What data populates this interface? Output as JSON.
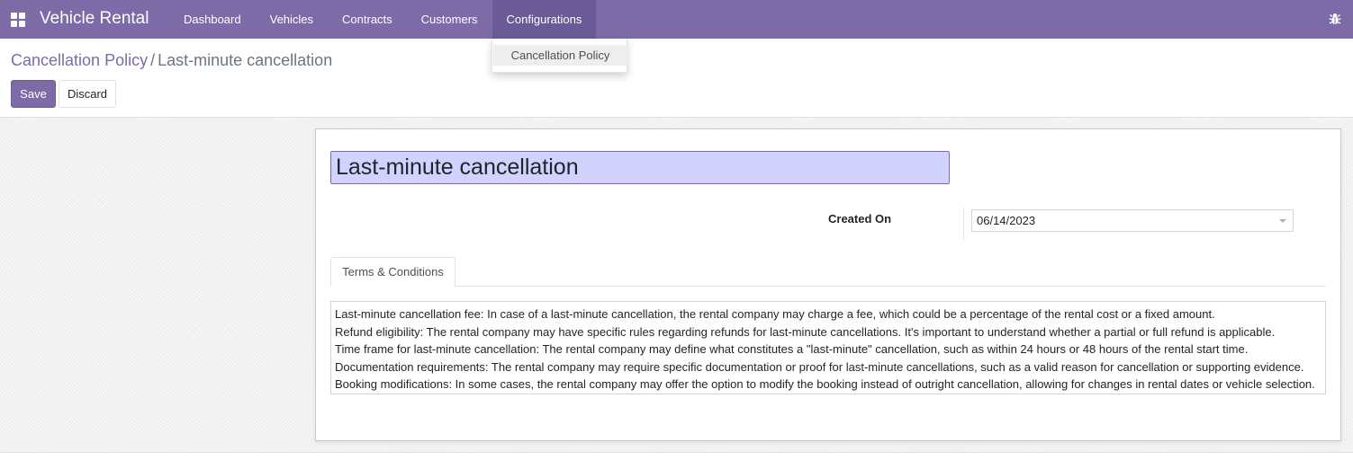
{
  "navbar": {
    "app_icon": "apps-grid-icon",
    "brand": "Vehicle Rental",
    "menu": [
      {
        "label": "Dashboard"
      },
      {
        "label": "Vehicles"
      },
      {
        "label": "Contracts"
      },
      {
        "label": "Customers"
      },
      {
        "label": "Configurations"
      }
    ],
    "active_menu": "Configurations",
    "debug_icon": "bug-icon"
  },
  "dropdown": {
    "items": [
      {
        "label": "Cancellation Policy"
      }
    ]
  },
  "breadcrumb": {
    "parent": "Cancellation Policy",
    "separator": "/",
    "current": "Last-minute cancellation"
  },
  "buttons": {
    "save": "Save",
    "discard": "Discard"
  },
  "form": {
    "name": "Last-minute cancellation",
    "created_on_label": "Created On",
    "created_on_value": "06/14/2023",
    "tab": "Terms & Conditions",
    "terms_lines": [
      "Last-minute cancellation fee: In case of a last-minute cancellation, the rental company may charge a fee, which could be a percentage of the rental cost or a fixed amount.",
      "Refund eligibility: The rental company may have specific rules regarding refunds for last-minute cancellations. It's important to understand whether a partial or full refund is applicable.",
      "Time frame for last-minute cancellation: The rental company may define what constitutes a \"last-minute\" cancellation, such as within 24 hours or 48 hours of the rental start time.",
      "Documentation requirements: The rental company may require specific documentation or proof for last-minute cancellations, such as a valid reason for cancellation or supporting evidence.",
      "Booking modifications: In some cases, the rental company may offer the option to modify the booking instead of outright cancellation, allowing for changes in rental dates or vehicle selection."
    ]
  },
  "colors": {
    "brand": "#7c6ba6",
    "active_menu": "#6a5a95",
    "title_field": "#d2d2ff"
  }
}
